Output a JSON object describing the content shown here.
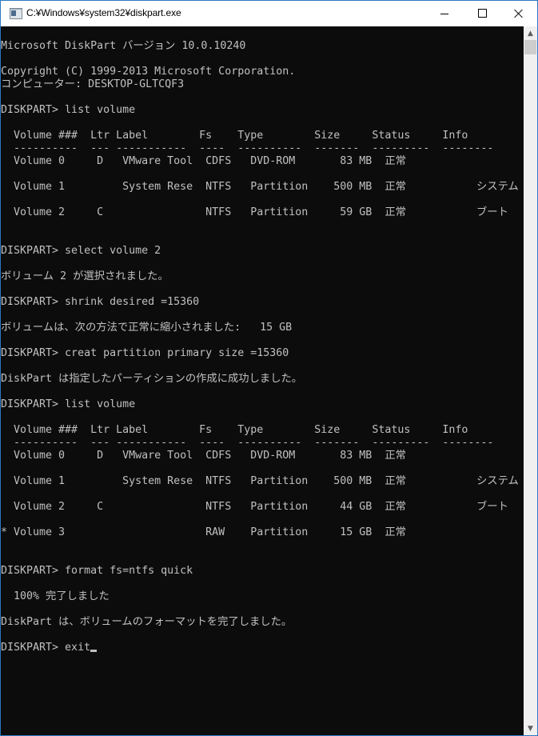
{
  "window": {
    "title": "C:¥Windows¥system32¥diskpart.exe",
    "icon": "console-app-icon",
    "controls": {
      "minimize": "minimize-icon",
      "maximize": "maximize-icon",
      "close": "close-icon"
    }
  },
  "console": {
    "prompt": "DISKPART>",
    "lines": [
      "Microsoft DiskPart バージョン 10.0.10240",
      "",
      "Copyright (C) 1999-2013 Microsoft Corporation.",
      "コンピューター: DESKTOP-GLTCQF3",
      "",
      "DISKPART> list volume",
      "",
      "  Volume ###  Ltr Label        Fs    Type        Size     Status     Info",
      "  ----------  --- -----------  ----  ----------  -------  ---------  --------",
      "  Volume 0     D   VMware Tool  CDFS   DVD-ROM       83 MB  正常",
      "",
      "  Volume 1         System Rese  NTFS   Partition    500 MB  正常           システム",
      "",
      "  Volume 2     C                NTFS   Partition     59 GB  正常           ブート",
      "",
      "",
      "DISKPART> select volume 2",
      "",
      "ボリューム 2 が選択されました。",
      "",
      "DISKPART> shrink desired =15360",
      "",
      "ボリュームは、次の方法で正常に縮小されました:   15 GB",
      "",
      "DISKPART> creat partition primary size =15360",
      "",
      "DiskPart は指定したパーティションの作成に成功しました。",
      "",
      "DISKPART> list volume",
      "",
      "  Volume ###  Ltr Label        Fs    Type        Size     Status     Info",
      "  ----------  --- -----------  ----  ----------  -------  ---------  --------",
      "  Volume 0     D   VMware Tool  CDFS   DVD-ROM       83 MB  正常",
      "",
      "  Volume 1         System Rese  NTFS   Partition    500 MB  正常           システム",
      "",
      "  Volume 2     C                NTFS   Partition     44 GB  正常           ブート",
      "",
      "* Volume 3                      RAW    Partition     15 GB  正常",
      "",
      "",
      "DISKPART> format fs=ntfs quick",
      "",
      "  100% 完了しました",
      "",
      "DiskPart は、ボリュームのフォーマットを完了しました。",
      "",
      "DISKPART> exit"
    ],
    "volume_tables": [
      {
        "headers": [
          "Volume ###",
          "Ltr",
          "Label",
          "Fs",
          "Type",
          "Size",
          "Status",
          "Info"
        ],
        "rows": [
          [
            "Volume 0",
            "D",
            "VMware Tool",
            "CDFS",
            "DVD-ROM",
            "83 MB",
            "正常",
            ""
          ],
          [
            "Volume 1",
            "",
            "System Rese",
            "NTFS",
            "Partition",
            "500 MB",
            "正常",
            "システム"
          ],
          [
            "Volume 2",
            "C",
            "",
            "NTFS",
            "Partition",
            "59 GB",
            "正常",
            "ブート"
          ]
        ]
      },
      {
        "headers": [
          "Volume ###",
          "Ltr",
          "Label",
          "Fs",
          "Type",
          "Size",
          "Status",
          "Info"
        ],
        "rows": [
          [
            "Volume 0",
            "D",
            "VMware Tool",
            "CDFS",
            "DVD-ROM",
            "83 MB",
            "正常",
            ""
          ],
          [
            "Volume 1",
            "",
            "System Rese",
            "NTFS",
            "Partition",
            "500 MB",
            "正常",
            "システム"
          ],
          [
            "Volume 2",
            "C",
            "",
            "NTFS",
            "Partition",
            "44 GB",
            "正常",
            "ブート"
          ],
          [
            "* Volume 3",
            "",
            "",
            "RAW",
            "Partition",
            "15 GB",
            "正常",
            ""
          ]
        ]
      }
    ],
    "current_input": "exit"
  },
  "scrollbar": {
    "up_icon": "scroll-up-arrow-icon",
    "down_icon": "scroll-down-arrow-icon",
    "position": 0
  },
  "colors": {
    "console_bg": "#0c0c0c",
    "console_fg": "#c0c0c0",
    "window_border": "#2b79c6",
    "titlebar_bg": "#ffffff"
  }
}
